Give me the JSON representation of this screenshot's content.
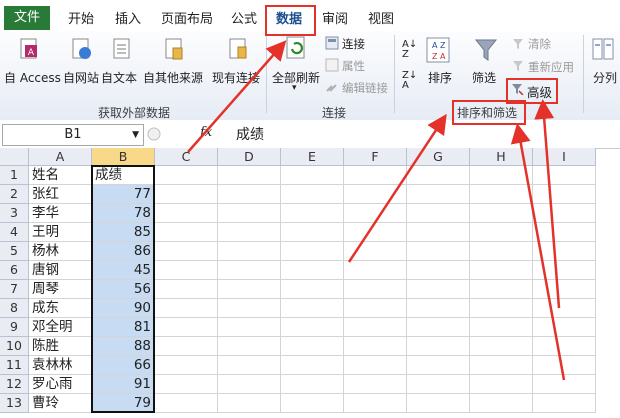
{
  "menubar": {
    "file": "文件",
    "tabs": [
      "开始",
      "插入",
      "页面布局",
      "公式",
      "数据",
      "审阅",
      "视图"
    ],
    "active": "数据"
  },
  "ribbon": {
    "external": {
      "buttons": [
        "自 Access",
        "自网站",
        "自文本",
        "自其他来源"
      ],
      "existing": "现有连接",
      "group_label": "获取外部数据"
    },
    "connections": {
      "refresh": "全部刷新",
      "connect": "连接",
      "properties": "属性",
      "edit_links": "编辑链接",
      "group_label": "连接"
    },
    "sort_filter": {
      "sort": "排序",
      "filter": "筛选",
      "clear": "清除",
      "reapply": "重新应用",
      "advanced": "高级",
      "group_label": "排序和筛选"
    },
    "split": "分列"
  },
  "formula_bar": {
    "name_box": "B1",
    "fx": "fx",
    "value": "成绩"
  },
  "sheet": {
    "col_headers": [
      "A",
      "B",
      "C",
      "D",
      "E",
      "F",
      "G",
      "H",
      "I"
    ],
    "row_numbers": [
      "1",
      "2",
      "3",
      "4",
      "5",
      "6",
      "7",
      "8",
      "9",
      "10",
      "11",
      "12",
      "13"
    ],
    "header_row": [
      "姓名",
      "成绩"
    ],
    "names": [
      "张红",
      "李华",
      "王明",
      "杨林",
      "唐钢",
      "周琴",
      "成东",
      "邓全明",
      "陈胜",
      "袁林林",
      "罗心雨",
      "曹玲"
    ],
    "scores": [
      "77",
      "78",
      "85",
      "86",
      "45",
      "56",
      "90",
      "81",
      "88",
      "66",
      "91",
      "79"
    ]
  },
  "colors": {
    "file_tab": "#2a7a37",
    "annotation": "#e4322b",
    "selection_fill": "#c7dcf2",
    "selected_header": "#f8d889"
  }
}
